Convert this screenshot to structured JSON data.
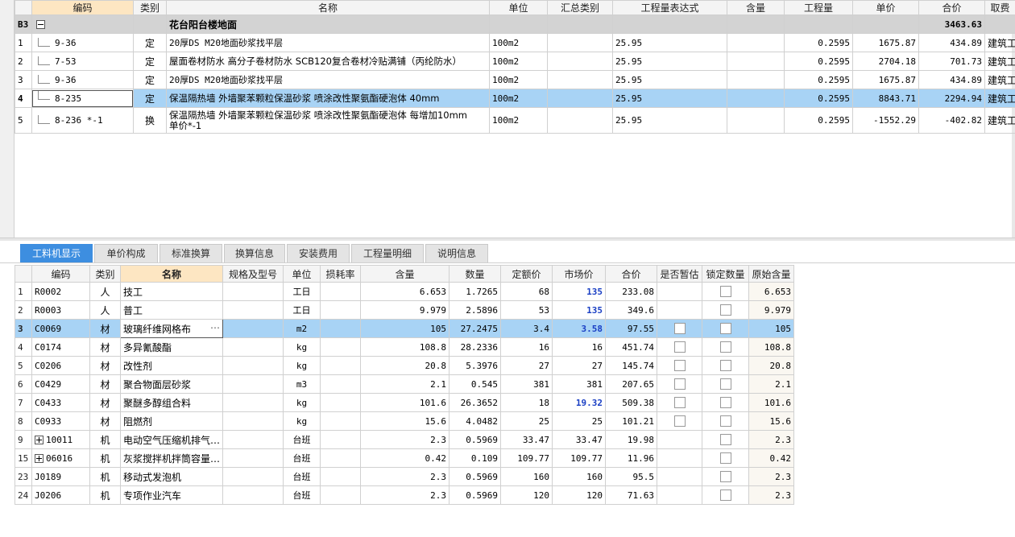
{
  "top": {
    "headers": [
      "编码",
      "类别",
      "名称",
      "单位",
      "汇总类别",
      "工程量表达式",
      "含量",
      "工程量",
      "单价",
      "合价",
      "取费"
    ],
    "group": {
      "id": "B3",
      "name": "花台阳台楼地面",
      "total": "3463.63"
    },
    "rows": [
      {
        "num": "1",
        "code": "9-36",
        "type": "定",
        "name": "20厚DS M20地面砂浆找平层",
        "unit": "100m2",
        "expr": "25.95",
        "qty": "0.2595",
        "price": "1675.87",
        "total": "434.89",
        "fee": "建筑工程"
      },
      {
        "num": "2",
        "code": "7-53",
        "type": "定",
        "name": "屋面卷材防水 高分子卷材防水 SCB120复合卷材冷贴满铺（丙纶防水）",
        "unit": "100m2",
        "expr": "25.95",
        "qty": "0.2595",
        "price": "2704.18",
        "total": "701.73",
        "fee": "建筑工程"
      },
      {
        "num": "3",
        "code": "9-36",
        "type": "定",
        "name": "20厚DS M20地面砂浆找平层",
        "unit": "100m2",
        "expr": "25.95",
        "qty": "0.2595",
        "price": "1675.87",
        "total": "434.89",
        "fee": "建筑工程"
      },
      {
        "num": "4",
        "code": "8-235",
        "type": "定",
        "name": "保温隔热墙 外墙聚苯颗粒保温砂浆 喷涂改性聚氨酯硬泡体 40mm",
        "unit": "100m2",
        "expr": "25.95",
        "qty": "0.2595",
        "price": "8843.71",
        "total": "2294.94",
        "fee": "建筑工程"
      },
      {
        "num": "5",
        "code": "8-236 *-1",
        "type": "换",
        "name1": "保温隔热墙 外墙聚苯颗粒保温砂浆 喷涂改性聚氨酯硬泡体 每增加10mm",
        "name2": "单价*-1",
        "unit": "100m2",
        "expr": "25.95",
        "qty": "0.2595",
        "price": "-1552.29",
        "total": "-402.82",
        "fee": "建筑工程"
      }
    ]
  },
  "tabs": [
    "工料机显示",
    "单价构成",
    "标准换算",
    "换算信息",
    "安装费用",
    "工程量明细",
    "说明信息"
  ],
  "bottom": {
    "headers": [
      "编码",
      "类别",
      "名称",
      "规格及型号",
      "单位",
      "损耗率",
      "含量",
      "数量",
      "定额价",
      "市场价",
      "合价",
      "是否暂估",
      "锁定数量",
      "原始含量"
    ],
    "rows": [
      {
        "num": "1",
        "code": "R0002",
        "type": "人",
        "name": "技工",
        "unit": "工日",
        "content": "6.653",
        "amount": "1.7265",
        "quota": "68",
        "market": "135",
        "total": "233.08",
        "orig": "6.653"
      },
      {
        "num": "2",
        "code": "R0003",
        "type": "人",
        "name": "普工",
        "unit": "工日",
        "content": "9.979",
        "amount": "2.5896",
        "quota": "53",
        "market": "135",
        "total": "349.6",
        "orig": "9.979"
      },
      {
        "num": "3",
        "code": "C0069",
        "type": "材",
        "name": "玻璃纤维网格布",
        "unit": "m2",
        "content": "105",
        "amount": "27.2475",
        "quota": "3.4",
        "market": "3.58",
        "total": "97.55",
        "orig": "105"
      },
      {
        "num": "4",
        "code": "C0174",
        "type": "材",
        "name": "多异氰酸酯",
        "unit": "kg",
        "content": "108.8",
        "amount": "28.2336",
        "quota": "16",
        "market": "16",
        "total": "451.74",
        "orig": "108.8"
      },
      {
        "num": "5",
        "code": "C0206",
        "type": "材",
        "name": "改性剂",
        "unit": "kg",
        "content": "20.8",
        "amount": "5.3976",
        "quota": "27",
        "market": "27",
        "total": "145.74",
        "orig": "20.8"
      },
      {
        "num": "6",
        "code": "C0429",
        "type": "材",
        "name": "聚合物面层砂浆",
        "unit": "m3",
        "content": "2.1",
        "amount": "0.545",
        "quota": "381",
        "market": "381",
        "total": "207.65",
        "orig": "2.1"
      },
      {
        "num": "7",
        "code": "C0433",
        "type": "材",
        "name": "聚醚多醇组合料",
        "unit": "kg",
        "content": "101.6",
        "amount": "26.3652",
        "quota": "18",
        "market": "19.32",
        "total": "509.38",
        "orig": "101.6"
      },
      {
        "num": "8",
        "code": "C0933",
        "type": "材",
        "name": "阻燃剂",
        "unit": "kg",
        "content": "15.6",
        "amount": "4.0482",
        "quota": "25",
        "market": "25",
        "total": "101.21",
        "orig": "15.6"
      },
      {
        "num": "9",
        "code": "10011",
        "type": "机",
        "name": "电动空气压缩机排气…",
        "unit": "台班",
        "content": "2.3",
        "amount": "0.5969",
        "quota": "33.47",
        "market": "33.47",
        "total": "19.98",
        "orig": "2.3"
      },
      {
        "num": "15",
        "code": "06016",
        "type": "机",
        "name": "灰浆搅拌机拌筒容量…",
        "unit": "台班",
        "content": "0.42",
        "amount": "0.109",
        "quota": "109.77",
        "market": "109.77",
        "total": "11.96",
        "orig": "0.42"
      },
      {
        "num": "23",
        "code": "J0189",
        "type": "机",
        "name": "移动式发泡机",
        "unit": "台班",
        "content": "2.3",
        "amount": "0.5969",
        "quota": "160",
        "market": "160",
        "total": "95.5",
        "orig": "2.3"
      },
      {
        "num": "24",
        "code": "J0206",
        "type": "机",
        "name": "专项作业汽车",
        "unit": "台班",
        "content": "2.3",
        "amount": "0.5969",
        "quota": "120",
        "market": "120",
        "total": "71.63",
        "orig": "2.3"
      }
    ]
  },
  "colors": {
    "tab_active": "#3d8ee0",
    "selection": "#a8d3f5",
    "group_row": "#d3d3d3",
    "market_changed": "#1a3fc4"
  }
}
